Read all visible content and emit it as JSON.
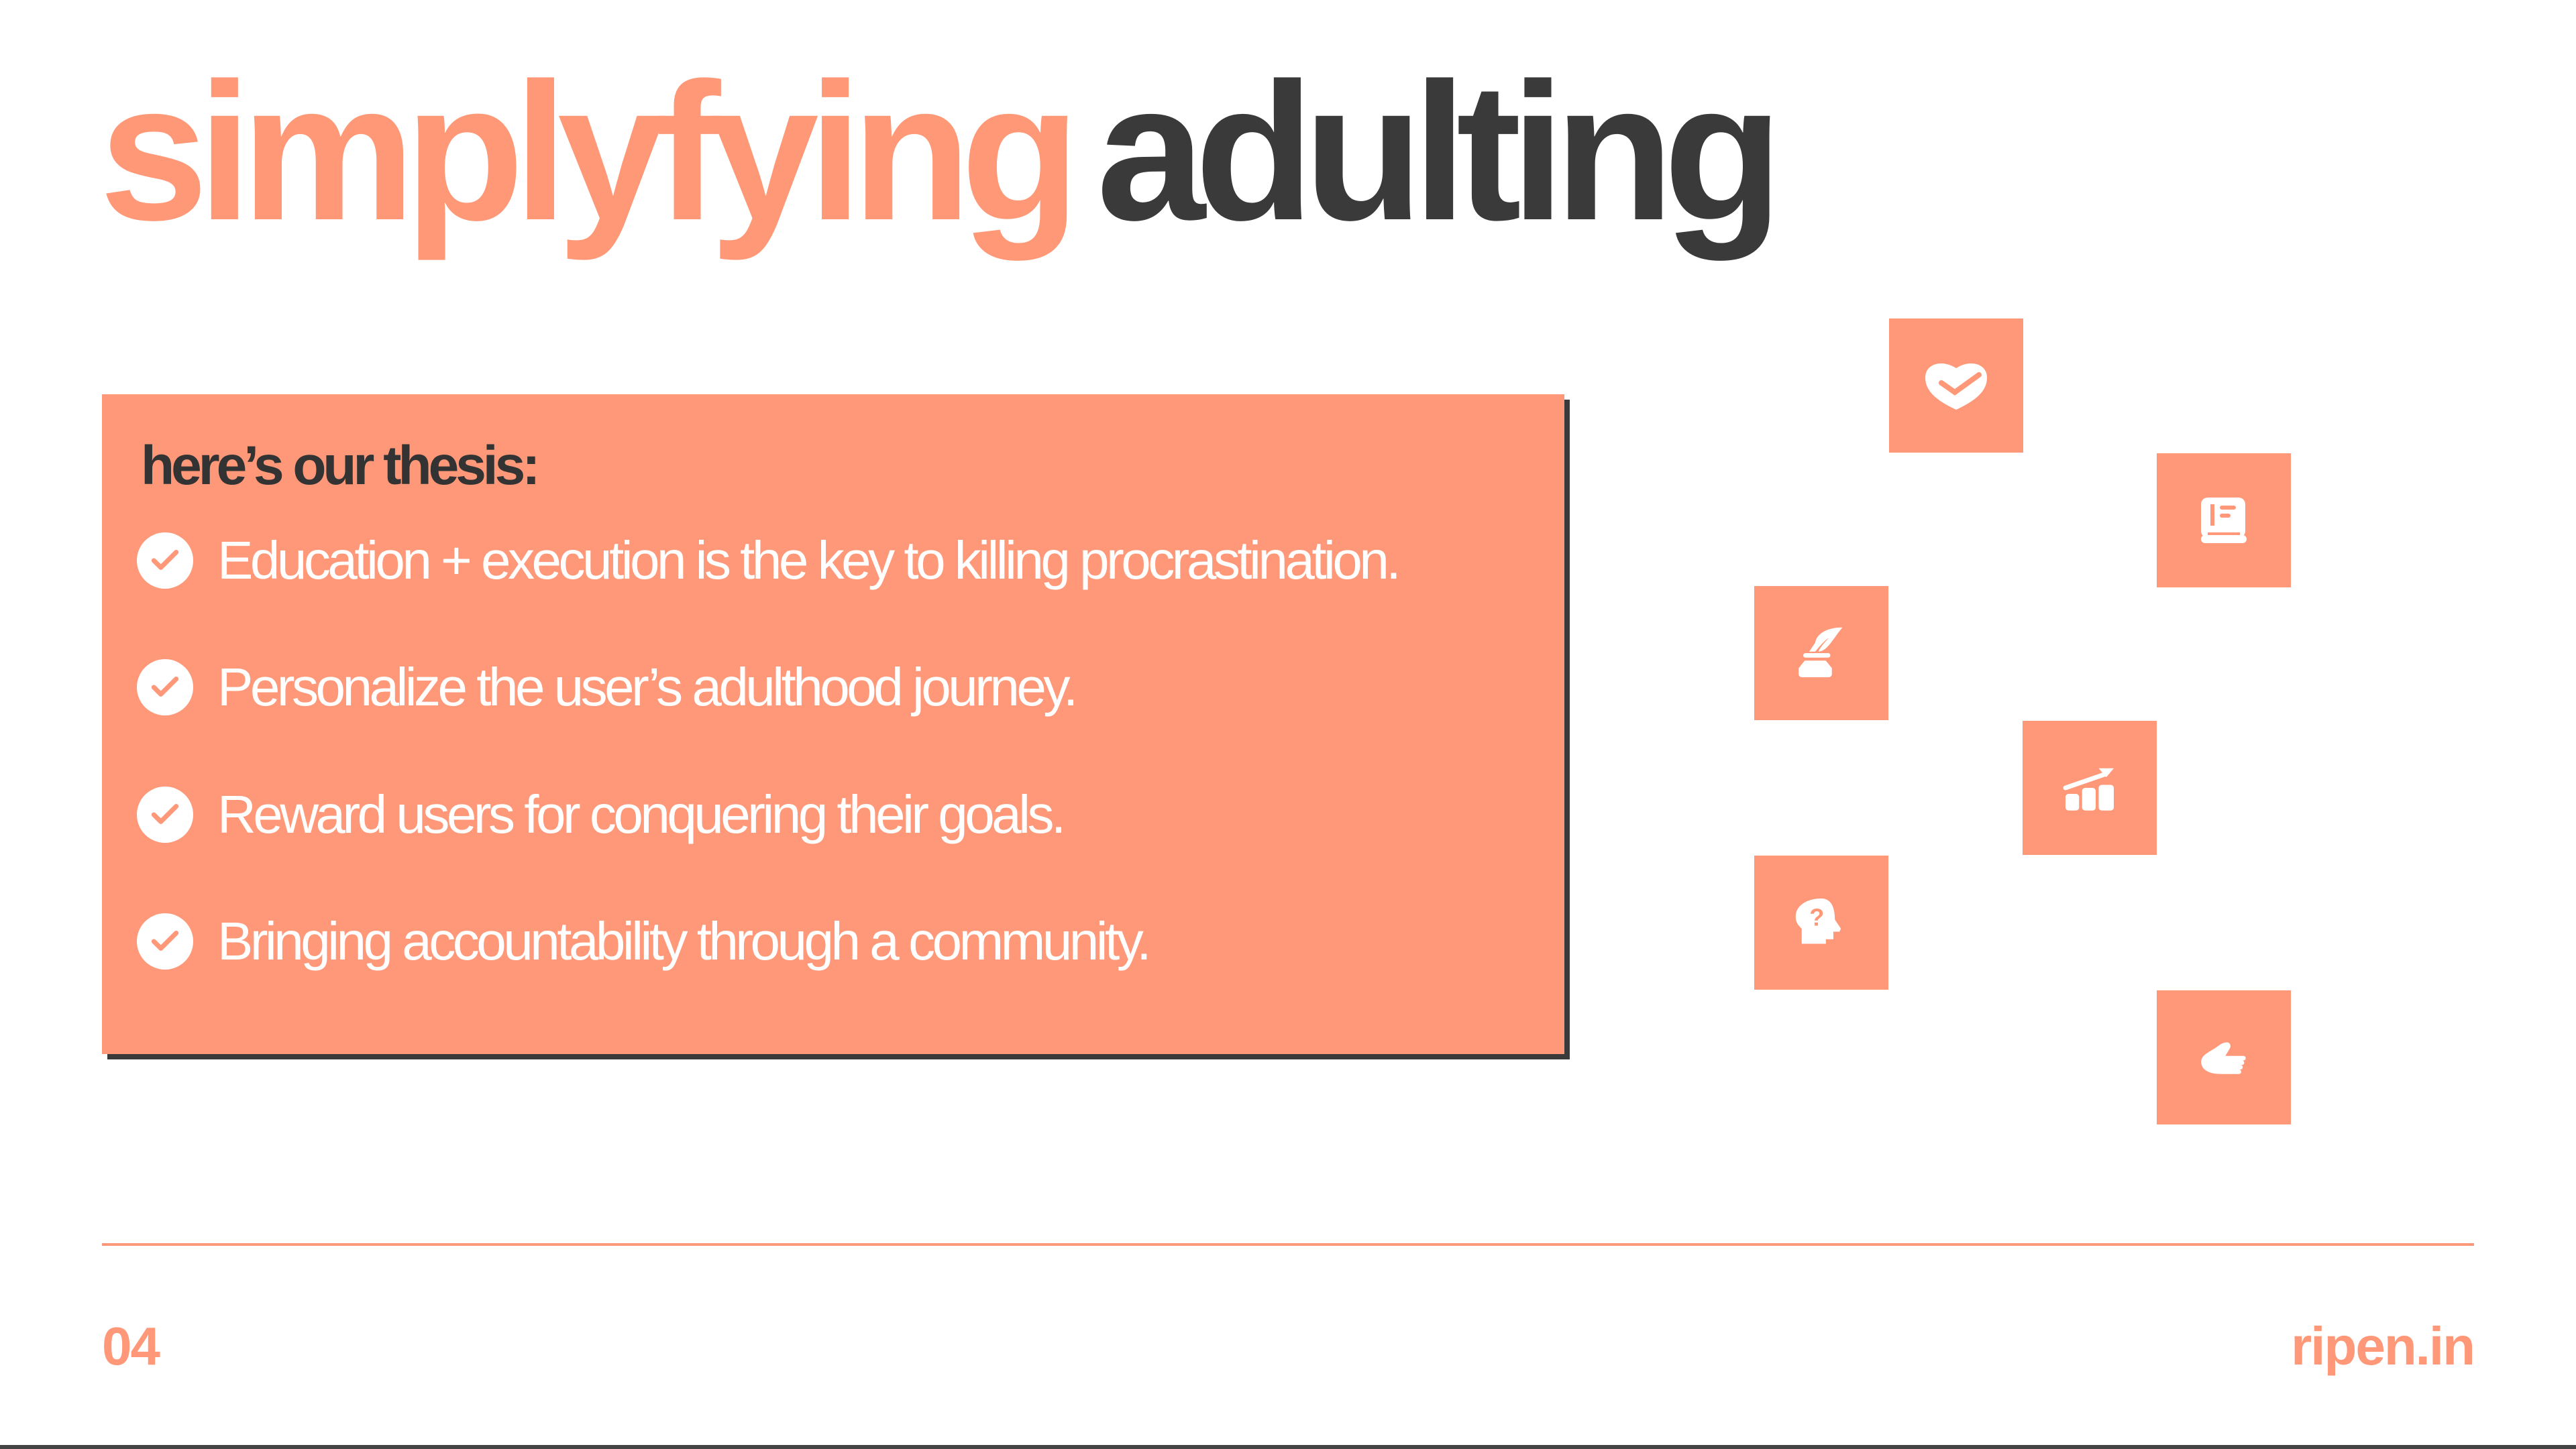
{
  "title": {
    "accent": "simplyfying",
    "main": "adulting"
  },
  "thesis": {
    "heading": "here’s our thesis:",
    "items": [
      "Education + execution is the key to killing procrastination.",
      "Personalize the user’s adulthood journey.",
      "Reward users for conquering their goals.",
      "Bringing accountability through a community."
    ]
  },
  "icons": [
    "heart-check-icon",
    "book-icon",
    "quill-ink-icon",
    "growth-chart-icon",
    "head-question-icon",
    "thumbs-up-icon"
  ],
  "footer": {
    "page_number": "04",
    "site": "ripen.in"
  },
  "colors": {
    "accent": "#FF9878",
    "dark": "#3a3a3a"
  }
}
